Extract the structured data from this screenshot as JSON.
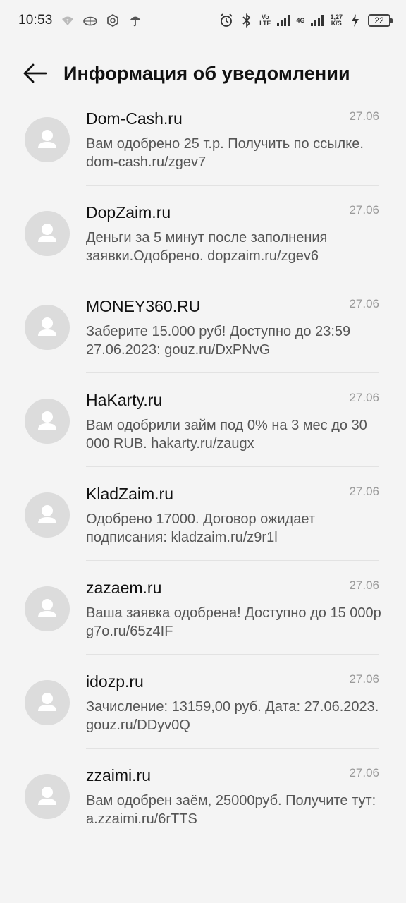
{
  "status_bar": {
    "time": "10:53",
    "net_top": "Vo",
    "net_bottom": "LTE",
    "net_4g": "4G",
    "speed_top": "1,27",
    "speed_bottom": "K/S",
    "battery": "22",
    "icons": [
      "wifi-hotspot-icon",
      "game-controller-icon",
      "vpn-hex-icon",
      "umbrella-icon",
      "alarm-icon",
      "bluetooth-icon",
      "signal-icon",
      "charging-icon"
    ]
  },
  "header": {
    "title": "Информация об уведомлении",
    "back_icon": "arrow-left-icon"
  },
  "notifications": [
    {
      "sender": "Dom-Cash.ru",
      "date": "27.06",
      "message": "Вам одобрено 25 т.р. Получить по ссылке. dom-cash.ru/zgev7"
    },
    {
      "sender": "DopZaim.ru",
      "date": "27.06",
      "message": "Деньги за 5 минут после заполнения заявки.Одобрено. dopzaim.ru/zgev6"
    },
    {
      "sender": "MONEY360.RU",
      "date": "27.06",
      "message": "Заберите 15.000 руб! Доступно до 23:59 27.06.2023: gouz.ru/DxPNvG"
    },
    {
      "sender": "HaKarty.ru",
      "date": "27.06",
      "message": "Вам одобрили займ под 0% на 3 мес до 30 000 RUB. hakarty.ru/zaugx"
    },
    {
      "sender": "KladZaim.ru",
      "date": "27.06",
      "message": "Одобрено 17000. Договор ожидает подписания: kladzaim.ru/z9r1l"
    },
    {
      "sender": "zazaem.ru",
      "date": "27.06",
      "message": "Ваша заявка одобрена! Доступно до 15 000р g7o.ru/65z4IF"
    },
    {
      "sender": "idozp.ru",
      "date": "27.06",
      "message": "Зачисление: 13159,00 руб. Дата: 27.06.2023. gouz.ru/DDyv0Q"
    },
    {
      "sender": "zzaimi.ru",
      "date": "27.06",
      "message": "Вам одобрен заём, 25000руб. Получите тут: a.zzaimi.ru/6rTTS"
    }
  ],
  "colors": {
    "background": "#f4f4f4",
    "avatar_bg": "#dcdcdc",
    "avatar_fg": "#ffffff",
    "date": "#9a9a9a",
    "message": "#555555"
  }
}
